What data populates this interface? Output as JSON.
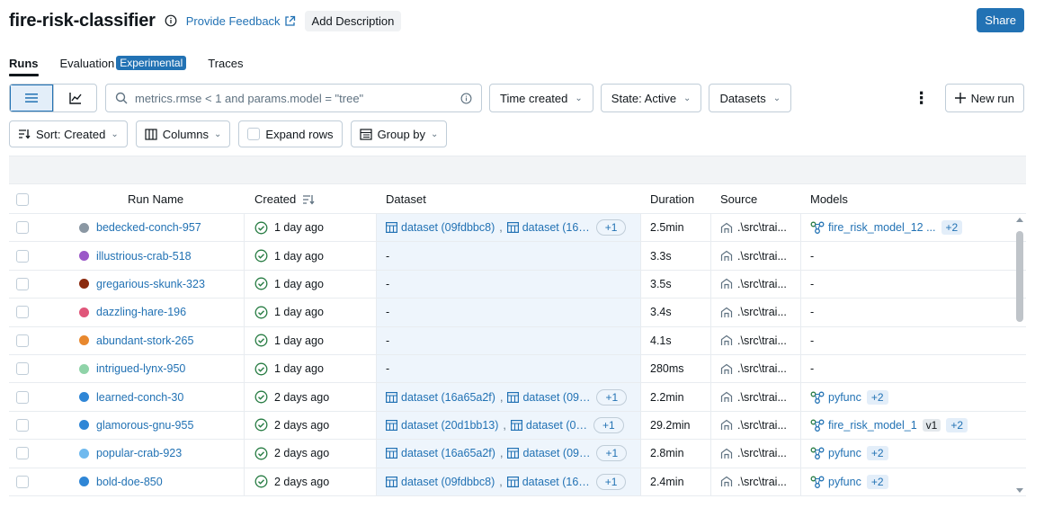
{
  "header": {
    "title": "fire-risk-classifier",
    "feedback_label": "Provide Feedback",
    "add_description_label": "Add Description",
    "share_label": "Share"
  },
  "tabs": [
    {
      "label": "Runs",
      "active": true
    },
    {
      "label": "Evaluation",
      "badge": "Experimental"
    },
    {
      "label": "Traces"
    }
  ],
  "toolbar": {
    "search_text": "metrics.rmse < 1 and params.model = \"tree\"",
    "time_created_label": "Time created",
    "state_label": "State: Active",
    "datasets_label": "Datasets",
    "new_run_label": "New run"
  },
  "toolbar2": {
    "sort_label": "Sort: Created",
    "columns_label": "Columns",
    "expand_rows_label": "Expand rows",
    "group_by_label": "Group by"
  },
  "table": {
    "headers": {
      "run_name": "Run Name",
      "created": "Created",
      "dataset": "Dataset",
      "duration": "Duration",
      "source": "Source",
      "models": "Models"
    },
    "rows": [
      {
        "name": "bedecked-conch-957",
        "color": "#8a97a3",
        "created": "1 day ago",
        "ds1": "dataset (09fdbbc8)",
        "ds2": "dataset (16…",
        "ds_more": "+1",
        "duration": "2.5min",
        "source": ".\\src\\trai...",
        "model": "fire_risk_model_12 ...",
        "model_version": "",
        "model_more": "+2"
      },
      {
        "name": "illustrious-crab-518",
        "color": "#9b59c8",
        "created": "1 day ago",
        "ds1": "-",
        "ds2": "",
        "ds_more": "",
        "duration": "3.3s",
        "source": ".\\src\\trai...",
        "model": "-",
        "model_version": "",
        "model_more": ""
      },
      {
        "name": "gregarious-skunk-323",
        "color": "#8b2a0e",
        "created": "1 day ago",
        "ds1": "-",
        "ds2": "",
        "ds_more": "",
        "duration": "3.5s",
        "source": ".\\src\\trai...",
        "model": "-",
        "model_version": "",
        "model_more": ""
      },
      {
        "name": "dazzling-hare-196",
        "color": "#e0567a",
        "created": "1 day ago",
        "ds1": "-",
        "ds2": "",
        "ds_more": "",
        "duration": "3.4s",
        "source": ".\\src\\trai...",
        "model": "-",
        "model_version": "",
        "model_more": ""
      },
      {
        "name": "abundant-stork-265",
        "color": "#e8882e",
        "created": "1 day ago",
        "ds1": "-",
        "ds2": "",
        "ds_more": "",
        "duration": "4.1s",
        "source": ".\\src\\trai...",
        "model": "-",
        "model_version": "",
        "model_more": ""
      },
      {
        "name": "intrigued-lynx-950",
        "color": "#8fd3a8",
        "created": "1 day ago",
        "ds1": "-",
        "ds2": "",
        "ds_more": "",
        "duration": "280ms",
        "source": ".\\src\\trai...",
        "model": "-",
        "model_version": "",
        "model_more": ""
      },
      {
        "name": "learned-conch-30",
        "color": "#2f86d6",
        "created": "2 days ago",
        "ds1": "dataset (16a65a2f)",
        "ds2": "dataset (09…",
        "ds_more": "+1",
        "duration": "2.2min",
        "source": ".\\src\\trai...",
        "model": "pyfunc",
        "model_version": "",
        "model_more": "+2"
      },
      {
        "name": "glamorous-gnu-955",
        "color": "#2f86d6",
        "created": "2 days ago",
        "ds1": "dataset (20d1bb13)",
        "ds2": "dataset (0…",
        "ds_more": "+1",
        "duration": "29.2min",
        "source": ".\\src\\trai...",
        "model": "fire_risk_model_1",
        "model_version": "v1",
        "model_more": "+2"
      },
      {
        "name": "popular-crab-923",
        "color": "#6fb9ee",
        "created": "2 days ago",
        "ds1": "dataset (16a65a2f)",
        "ds2": "dataset (09…",
        "ds_more": "+1",
        "duration": "2.8min",
        "source": ".\\src\\trai...",
        "model": "pyfunc",
        "model_version": "",
        "model_more": "+2"
      },
      {
        "name": "bold-doe-850",
        "color": "#2f86d6",
        "created": "2 days ago",
        "ds1": "dataset (09fdbbc8)",
        "ds2": "dataset (16…",
        "ds_more": "+1",
        "duration": "2.4min",
        "source": ".\\src\\trai...",
        "model": "pyfunc",
        "model_version": "",
        "model_more": "+2"
      }
    ]
  }
}
